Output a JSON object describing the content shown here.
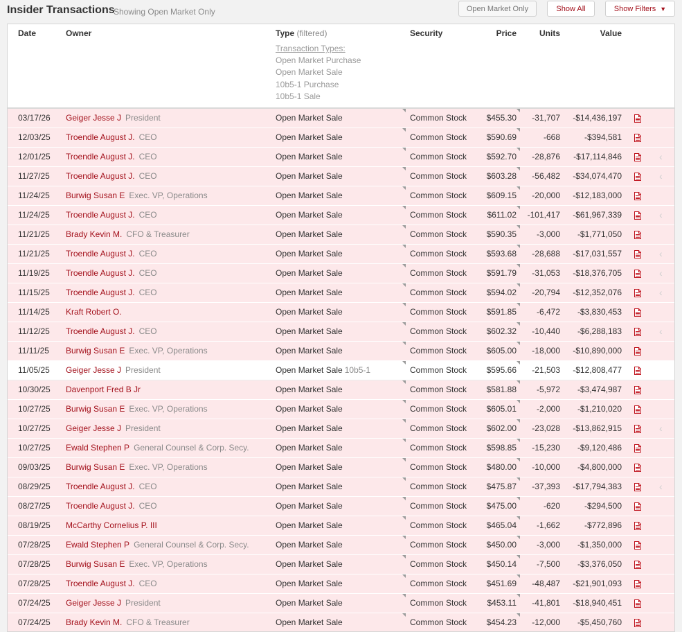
{
  "header": {
    "title": "Insider Transactions",
    "subtitle": "Showing Open Market Only",
    "buttons": {
      "open_market": "Open Market Only",
      "show_all": "Show All",
      "show_filters": "Show Filters"
    }
  },
  "columns": {
    "date": "Date",
    "owner": "Owner",
    "type": "Type",
    "type_filtered": "(filtered)",
    "security": "Security",
    "price": "Price",
    "units": "Units",
    "value": "Value"
  },
  "transaction_types": {
    "title": "Transaction Types:",
    "options": [
      "Open Market Purchase",
      "Open Market Sale",
      "10b5-1 Purchase",
      "10b5-1 Sale"
    ]
  },
  "colors": {
    "accent": "#a3101b",
    "row_highlight": "#fde8ea",
    "muted": "#8a8a8a"
  },
  "rows": [
    {
      "date": "03/17/26",
      "owner": "Geiger Jesse J",
      "role": "President",
      "type": "Open Market Sale",
      "type_extra": "",
      "security": "Common Stock",
      "price": "$455.30",
      "units": "-31,707",
      "value": "-$14,436,197",
      "highlight": true,
      "back": false
    },
    {
      "date": "12/03/25",
      "owner": "Troendle August J.",
      "role": "CEO",
      "type": "Open Market Sale",
      "type_extra": "",
      "security": "Common Stock",
      "price": "$590.69",
      "units": "-668",
      "value": "-$394,581",
      "highlight": true,
      "back": false
    },
    {
      "date": "12/01/25",
      "owner": "Troendle August J.",
      "role": "CEO",
      "type": "Open Market Sale",
      "type_extra": "",
      "security": "Common Stock",
      "price": "$592.70",
      "units": "-28,876",
      "value": "-$17,114,846",
      "highlight": true,
      "back": true
    },
    {
      "date": "11/27/25",
      "owner": "Troendle August J.",
      "role": "CEO",
      "type": "Open Market Sale",
      "type_extra": "",
      "security": "Common Stock",
      "price": "$603.28",
      "units": "-56,482",
      "value": "-$34,074,470",
      "highlight": true,
      "back": true
    },
    {
      "date": "11/24/25",
      "owner": "Burwig Susan E",
      "role": "Exec. VP, Operations",
      "type": "Open Market Sale",
      "type_extra": "",
      "security": "Common Stock",
      "price": "$609.15",
      "units": "-20,000",
      "value": "-$12,183,000",
      "highlight": true,
      "back": false
    },
    {
      "date": "11/24/25",
      "owner": "Troendle August J.",
      "role": "CEO",
      "type": "Open Market Sale",
      "type_extra": "",
      "security": "Common Stock",
      "price": "$611.02",
      "units": "-101,417",
      "value": "-$61,967,339",
      "highlight": true,
      "back": true
    },
    {
      "date": "11/21/25",
      "owner": "Brady Kevin M.",
      "role": "CFO & Treasurer",
      "type": "Open Market Sale",
      "type_extra": "",
      "security": "Common Stock",
      "price": "$590.35",
      "units": "-3,000",
      "value": "-$1,771,050",
      "highlight": true,
      "back": false
    },
    {
      "date": "11/21/25",
      "owner": "Troendle August J.",
      "role": "CEO",
      "type": "Open Market Sale",
      "type_extra": "",
      "security": "Common Stock",
      "price": "$593.68",
      "units": "-28,688",
      "value": "-$17,031,557",
      "highlight": true,
      "back": true
    },
    {
      "date": "11/19/25",
      "owner": "Troendle August J.",
      "role": "CEO",
      "type": "Open Market Sale",
      "type_extra": "",
      "security": "Common Stock",
      "price": "$591.79",
      "units": "-31,053",
      "value": "-$18,376,705",
      "highlight": true,
      "back": true
    },
    {
      "date": "11/15/25",
      "owner": "Troendle August J.",
      "role": "CEO",
      "type": "Open Market Sale",
      "type_extra": "",
      "security": "Common Stock",
      "price": "$594.02",
      "units": "-20,794",
      "value": "-$12,352,076",
      "highlight": true,
      "back": true
    },
    {
      "date": "11/14/25",
      "owner": "Kraft Robert O.",
      "role": "",
      "type": "Open Market Sale",
      "type_extra": "",
      "security": "Common Stock",
      "price": "$591.85",
      "units": "-6,472",
      "value": "-$3,830,453",
      "highlight": true,
      "back": false
    },
    {
      "date": "11/12/25",
      "owner": "Troendle August J.",
      "role": "CEO",
      "type": "Open Market Sale",
      "type_extra": "",
      "security": "Common Stock",
      "price": "$602.32",
      "units": "-10,440",
      "value": "-$6,288,183",
      "highlight": true,
      "back": true
    },
    {
      "date": "11/11/25",
      "owner": "Burwig Susan E",
      "role": "Exec. VP, Operations",
      "type": "Open Market Sale",
      "type_extra": "",
      "security": "Common Stock",
      "price": "$605.00",
      "units": "-18,000",
      "value": "-$10,890,000",
      "highlight": true,
      "back": false
    },
    {
      "date": "11/05/25",
      "owner": "Geiger Jesse J",
      "role": "President",
      "type": "Open Market Sale",
      "type_extra": "10b5-1",
      "security": "Common Stock",
      "price": "$595.66",
      "units": "-21,503",
      "value": "-$12,808,477",
      "highlight": false,
      "back": false
    },
    {
      "date": "10/30/25",
      "owner": "Davenport Fred B Jr",
      "role": "",
      "type": "Open Market Sale",
      "type_extra": "",
      "security": "Common Stock",
      "price": "$581.88",
      "units": "-5,972",
      "value": "-$3,474,987",
      "highlight": true,
      "back": false
    },
    {
      "date": "10/27/25",
      "owner": "Burwig Susan E",
      "role": "Exec. VP, Operations",
      "type": "Open Market Sale",
      "type_extra": "",
      "security": "Common Stock",
      "price": "$605.01",
      "units": "-2,000",
      "value": "-$1,210,020",
      "highlight": true,
      "back": false
    },
    {
      "date": "10/27/25",
      "owner": "Geiger Jesse J",
      "role": "President",
      "type": "Open Market Sale",
      "type_extra": "",
      "security": "Common Stock",
      "price": "$602.00",
      "units": "-23,028",
      "value": "-$13,862,915",
      "highlight": true,
      "back": true
    },
    {
      "date": "10/27/25",
      "owner": "Ewald Stephen P",
      "role": "General Counsel & Corp. Secy.",
      "type": "Open Market Sale",
      "type_extra": "",
      "security": "Common Stock",
      "price": "$598.85",
      "units": "-15,230",
      "value": "-$9,120,486",
      "highlight": true,
      "back": false
    },
    {
      "date": "09/03/25",
      "owner": "Burwig Susan E",
      "role": "Exec. VP, Operations",
      "type": "Open Market Sale",
      "type_extra": "",
      "security": "Common Stock",
      "price": "$480.00",
      "units": "-10,000",
      "value": "-$4,800,000",
      "highlight": true,
      "back": false
    },
    {
      "date": "08/29/25",
      "owner": "Troendle August J.",
      "role": "CEO",
      "type": "Open Market Sale",
      "type_extra": "",
      "security": "Common Stock",
      "price": "$475.87",
      "units": "-37,393",
      "value": "-$17,794,383",
      "highlight": true,
      "back": true
    },
    {
      "date": "08/27/25",
      "owner": "Troendle August J.",
      "role": "CEO",
      "type": "Open Market Sale",
      "type_extra": "",
      "security": "Common Stock",
      "price": "$475.00",
      "units": "-620",
      "value": "-$294,500",
      "highlight": true,
      "back": false
    },
    {
      "date": "08/19/25",
      "owner": "McCarthy Cornelius P. III",
      "role": "",
      "type": "Open Market Sale",
      "type_extra": "",
      "security": "Common Stock",
      "price": "$465.04",
      "units": "-1,662",
      "value": "-$772,896",
      "highlight": true,
      "back": false
    },
    {
      "date": "07/28/25",
      "owner": "Ewald Stephen P",
      "role": "General Counsel & Corp. Secy.",
      "type": "Open Market Sale",
      "type_extra": "",
      "security": "Common Stock",
      "price": "$450.00",
      "units": "-3,000",
      "value": "-$1,350,000",
      "highlight": true,
      "back": false
    },
    {
      "date": "07/28/25",
      "owner": "Burwig Susan E",
      "role": "Exec. VP, Operations",
      "type": "Open Market Sale",
      "type_extra": "",
      "security": "Common Stock",
      "price": "$450.14",
      "units": "-7,500",
      "value": "-$3,376,050",
      "highlight": true,
      "back": false
    },
    {
      "date": "07/28/25",
      "owner": "Troendle August J.",
      "role": "CEO",
      "type": "Open Market Sale",
      "type_extra": "",
      "security": "Common Stock",
      "price": "$451.69",
      "units": "-48,487",
      "value": "-$21,901,093",
      "highlight": true,
      "back": false
    },
    {
      "date": "07/24/25",
      "owner": "Geiger Jesse J",
      "role": "President",
      "type": "Open Market Sale",
      "type_extra": "",
      "security": "Common Stock",
      "price": "$453.11",
      "units": "-41,801",
      "value": "-$18,940,451",
      "highlight": true,
      "back": false
    },
    {
      "date": "07/24/25",
      "owner": "Brady Kevin M.",
      "role": "CFO & Treasurer",
      "type": "Open Market Sale",
      "type_extra": "",
      "security": "Common Stock",
      "price": "$454.23",
      "units": "-12,000",
      "value": "-$5,450,760",
      "highlight": true,
      "back": false
    }
  ]
}
